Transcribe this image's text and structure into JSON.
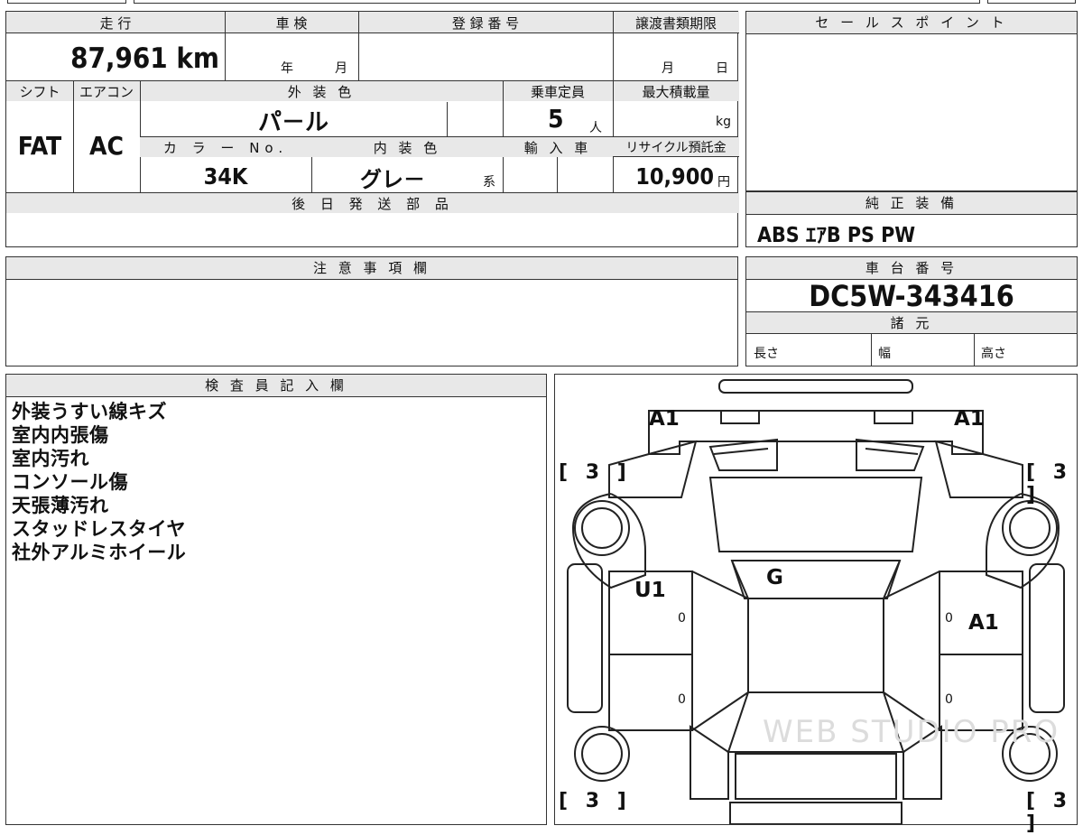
{
  "main_grid": {
    "mileage_label": "走 行",
    "mileage_value": "87,961 km",
    "inspection_label": "車 検",
    "inspection_year": "年",
    "inspection_month": "月",
    "registration_label": "登 録 番 号",
    "transfer_label": "譲渡書類期限",
    "transfer_month": "月",
    "transfer_day": "日",
    "shift_label": "シフト",
    "shift_value": "FAT",
    "aircon_label": "エアコン",
    "aircon_value": "AC",
    "exterior_label": "外 装 色",
    "exterior_value": "パ－ル",
    "capacity_label": "乗車定員",
    "capacity_value": "5",
    "capacity_unit": "人",
    "maxload_label": "最大積載量",
    "maxload_unit": "kg",
    "color_no_label": "カ ラ ー No.",
    "color_no_value": "34K",
    "interior_label": "内 装 色",
    "interior_value": "グレ－",
    "interior_suffix": "系",
    "import_label": "輸 入 車",
    "recycle_label": "リサイクル預託金",
    "recycle_value": "10,900",
    "recycle_unit": "円",
    "later_parts_label": "後 日 発 送 部 品"
  },
  "sales_point": {
    "label": "セ ー ル ス ポ イ ン ト"
  },
  "equipment": {
    "label": "純 正 装 備",
    "value": "ABS ｴｱB PS PW"
  },
  "caution": {
    "label": "注 意 事 項 欄"
  },
  "chassis": {
    "label": "車 台 番 号",
    "value": "DC5W-343416"
  },
  "specs": {
    "label": "諸 元",
    "length": "長さ",
    "width": "幅",
    "height": "高さ"
  },
  "inspector": {
    "label": "検 査 員 記 入 欄",
    "notes": [
      "外装うすい線キズ",
      "室内内張傷",
      "室内汚れ",
      "コンソール傷",
      "天張薄汚れ",
      "スタッドレスタイヤ",
      "社外アルミホイール"
    ]
  },
  "diagram": {
    "marks": {
      "front_left": "A1",
      "front_right": "A1",
      "roof": "G",
      "left_door": "U1",
      "right_door": "A1"
    },
    "tires": {
      "fl": "3",
      "fr": "3",
      "rl": "3",
      "rr": "3"
    },
    "door_zeros": [
      "0",
      "0",
      "0",
      "0"
    ],
    "watermark": "WEB STUDIO PRO"
  }
}
